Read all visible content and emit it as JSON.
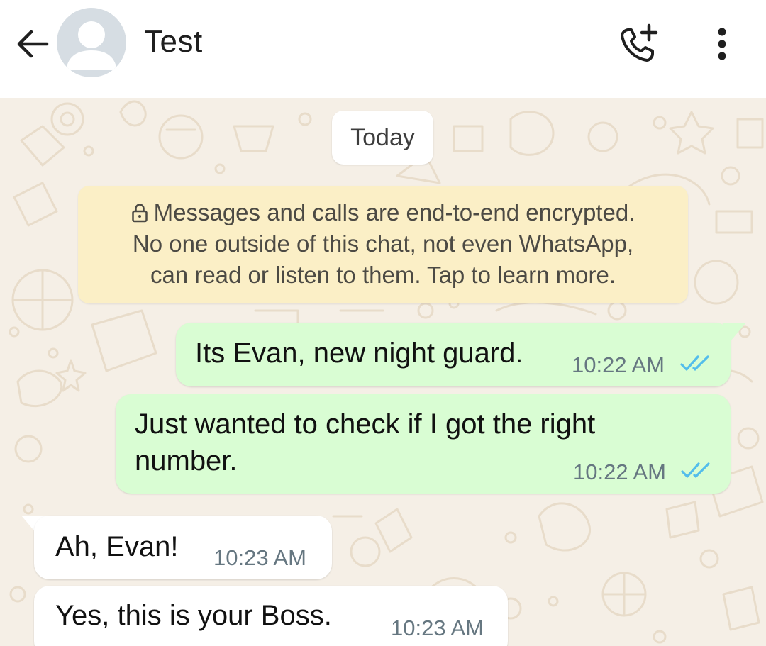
{
  "header": {
    "back_icon": "arrow-left-icon",
    "avatar_icon": "person-icon",
    "title": "Test",
    "call_icon": "phone-add-icon",
    "menu_icon": "more-vertical-icon"
  },
  "chat": {
    "date_chip": "Today",
    "encryption_notice": {
      "icon": "lock-icon",
      "lines": [
        "Messages and calls are end-to-end encrypted.",
        "No one outside of this chat, not even WhatsApp,",
        "can read or listen to them. Tap to learn more."
      ]
    },
    "messages": [
      {
        "direction": "outgoing",
        "lines": [
          "Its Evan, new night guard."
        ],
        "time": "10:22 AM",
        "status": "read"
      },
      {
        "direction": "outgoing",
        "lines": [
          "Just wanted to check if I got the right",
          "number."
        ],
        "time": "10:22 AM",
        "status": "read"
      },
      {
        "direction": "incoming",
        "lines": [
          "Ah, Evan!"
        ],
        "time": "10:23 AM"
      },
      {
        "direction": "incoming",
        "lines": [
          "Yes, this is your Boss."
        ],
        "time": "10:23 AM"
      }
    ]
  },
  "colors": {
    "header_bg": "#ffffff",
    "chat_bg": "#f5efe6",
    "outgoing_bubble": "#d9fdd3",
    "incoming_bubble": "#ffffff",
    "notice_bg": "#fbefc6",
    "read_ticks": "#53bdeb",
    "meta_text": "#667781"
  }
}
